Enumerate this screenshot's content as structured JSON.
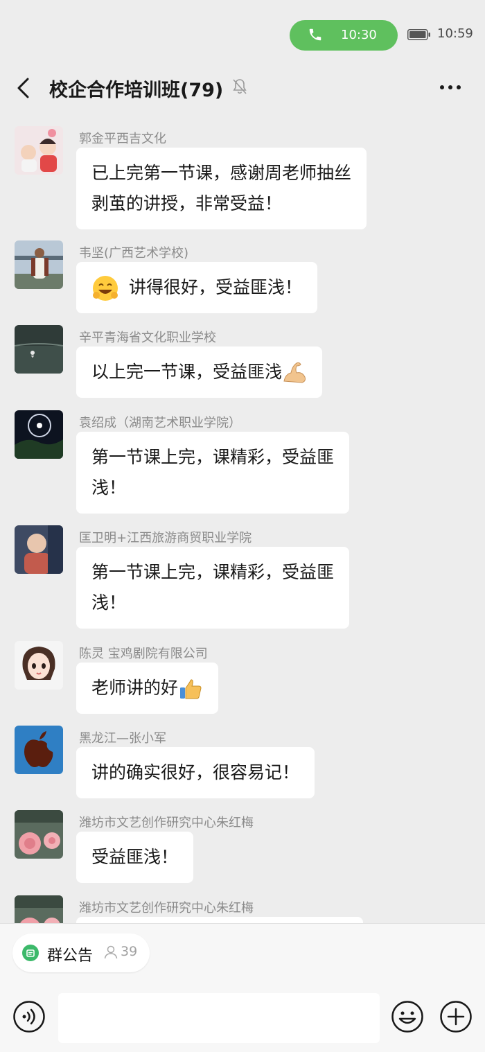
{
  "status_bar": {
    "call_time": "10:30",
    "clock": "10:59"
  },
  "header": {
    "title": "校企合作培训班(79)",
    "more_label": "···"
  },
  "messages": [
    {
      "sender": "郭金平西吉文化",
      "text": "已上完第一节课，感谢周老师抽丝\n剥茧的讲授，非常受益！"
    },
    {
      "sender": "韦坚(广西艺术学校)",
      "text": "讲得很好，受益匪浅！",
      "leading_emoji": "smile-emoji"
    },
    {
      "sender": "辛平青海省文化职业学校",
      "text": "以上完一节课，受益匪浅",
      "trailing_emoji": "flexed-biceps-emoji"
    },
    {
      "sender": "袁绍成（湖南艺术职业学院）",
      "text": "第一节课上完，课精彩，受益匪\n浅！"
    },
    {
      "sender": "匡卫明+江西旅游商贸职业学院",
      "text": "第一节课上完，课精彩，受益匪\n浅！"
    },
    {
      "sender": "陈灵  宝鸡剧院有限公司",
      "text": "老师讲的好",
      "trailing_emoji": "thumbs-up-emoji"
    },
    {
      "sender": "黑龙江—张小军",
      "text": "讲的确实很好，很容易记！"
    },
    {
      "sender": "潍坊市文艺创作研究中心朱红梅",
      "text": "受益匪浅！"
    },
    {
      "sender": "潍坊市文艺创作研究中心朱红梅",
      "text": ""
    }
  ],
  "bottom_bar": {
    "notice_label": "群公告",
    "people_count": "39",
    "input_placeholder": ""
  },
  "colors": {
    "background": "#ededed",
    "call_green": "#5fc05e",
    "bubble": "#ffffff",
    "sender_gray": "#8a8a8a"
  }
}
